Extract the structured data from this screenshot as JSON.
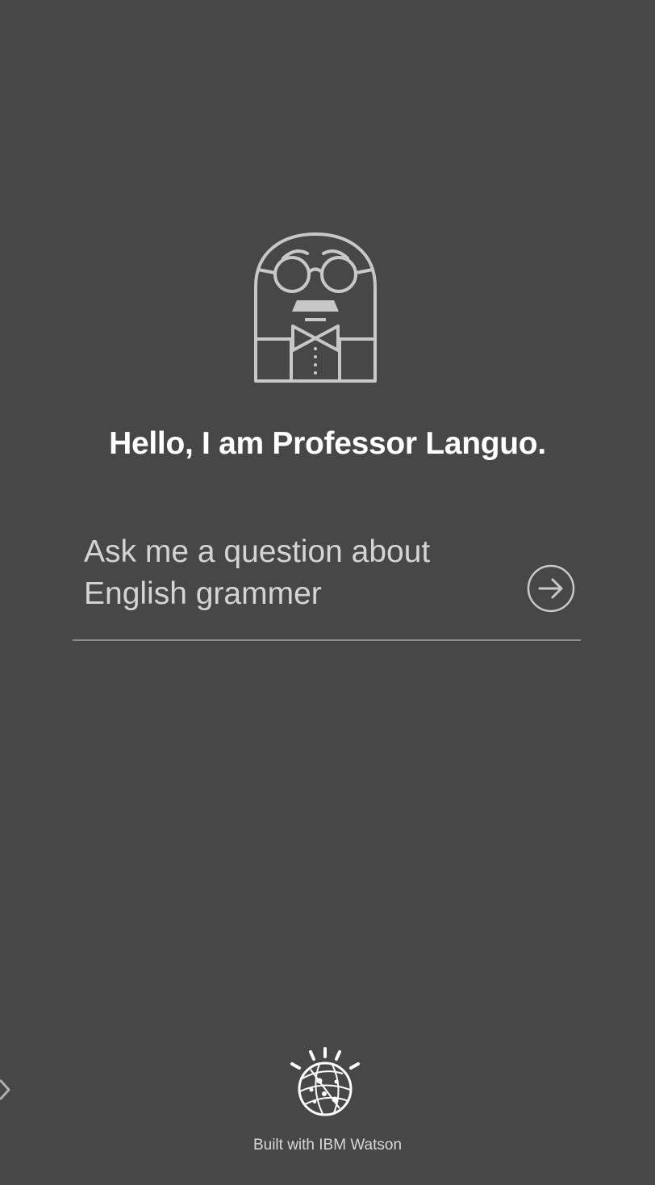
{
  "greeting": "Hello, I am Professor Languo.",
  "question": {
    "placeholder": "Ask me a question about\nEnglish grammer",
    "value": ""
  },
  "submit": {
    "icon": "arrow-right-circle-icon",
    "label": "Submit question"
  },
  "mascot": {
    "icon": "professor-mascot-icon"
  },
  "side_nav": {
    "icon": "chevron-right-icon"
  },
  "footer": {
    "logo_icon": "ibm-watson-logo-icon",
    "credit": "Built with IBM Watson"
  },
  "colors": {
    "background": "#474747",
    "text_primary": "#ffffff",
    "text_secondary": "#d4d4d4",
    "icon_stroke": "#c8c8c8",
    "divider": "#8a8a8a"
  }
}
